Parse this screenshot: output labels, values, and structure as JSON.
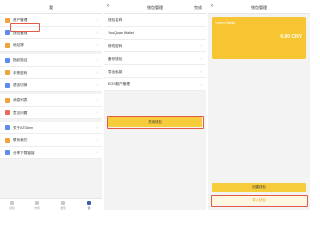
{
  "screen1": {
    "title": "我",
    "menu": [
      {
        "label": "资产管理",
        "icon": "asset-icon",
        "color": "#f0a23b"
      },
      {
        "label": "钱包管理",
        "icon": "wallet-icon",
        "color": "#5b8def"
      },
      {
        "label": "地址簿",
        "icon": "address-book-icon",
        "color": "#f0a23b"
      },
      {
        "label": "指纹验证",
        "icon": "fingerprint-icon",
        "color": "#5b8def"
      },
      {
        "label": "手势密码",
        "icon": "gesture-icon",
        "color": "#f0a23b"
      },
      {
        "label": "语言切换",
        "icon": "language-icon",
        "color": "#5b8def"
      },
      {
        "label": "消息列表",
        "icon": "message-icon",
        "color": "#f0a23b"
      },
      {
        "label": "意见问题",
        "icon": "feedback-icon",
        "color": "#e66b5b"
      },
      {
        "label": "关于ATOken",
        "icon": "about-icon",
        "color": "#5b8def"
      },
      {
        "label": "联系我们",
        "icon": "contact-icon",
        "color": "#f0a23b"
      },
      {
        "label": "分享下载链接",
        "icon": "share-icon",
        "color": "#5b8def"
      }
    ],
    "tabs": [
      {
        "label": "钱包"
      },
      {
        "label": "市场"
      },
      {
        "label": "发现"
      },
      {
        "label": "我"
      }
    ]
  },
  "screen2": {
    "title": "钱包管理",
    "done": "完成",
    "menu": [
      {
        "label": "钱包名称"
      },
      {
        "label": "YouQuan Wallet"
      },
      {
        "label": "修改密码"
      },
      {
        "label": "备份钱包"
      },
      {
        "label": "导出私钥"
      },
      {
        "label": "EOS账户管理"
      }
    ],
    "button": "关闭钱包"
  },
  "screen3": {
    "title": "钱包管理",
    "card_name": "Yorizen Wallet",
    "card_balance": "0.00 CNY",
    "button_primary": "创建钱包",
    "button_secondary": "导入钱包"
  }
}
